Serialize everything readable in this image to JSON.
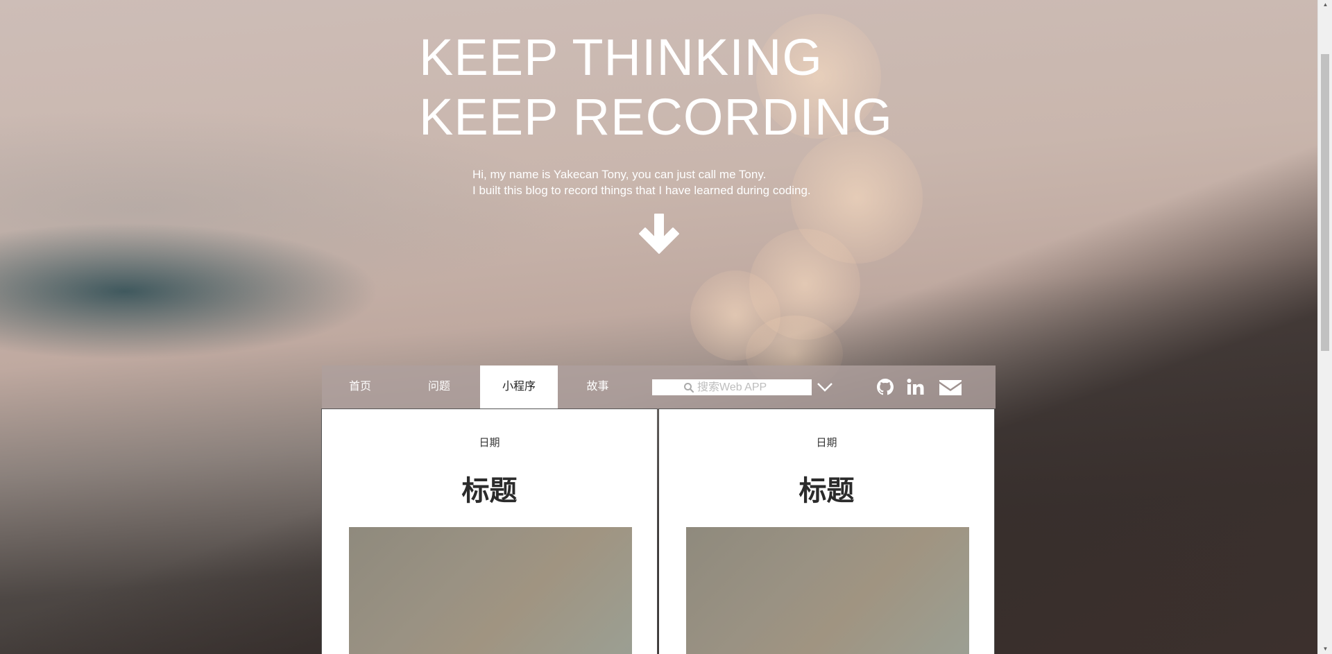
{
  "hero": {
    "title_line1": "KEEP THINKING",
    "title_line2": "KEEP RECORDING",
    "intro_line1": "Hi, my name is Yakecan Tony, you can just call me Tony.",
    "intro_line2": "I built this blog to record things that I have learned during coding.",
    "scroll_icon": "arrow-down-icon"
  },
  "nav": {
    "tabs": [
      {
        "label": "首页",
        "active": false
      },
      {
        "label": "问题",
        "active": false
      },
      {
        "label": "小程序",
        "active": true
      },
      {
        "label": "故事",
        "active": false
      }
    ],
    "search": {
      "placeholder": "搜索Web APP",
      "icon": "search-icon"
    },
    "dropdown_icon": "chevron-down-icon",
    "social": [
      "github-icon",
      "linkedin-icon",
      "envelope-icon"
    ]
  },
  "cards": [
    {
      "date": "日期",
      "title": "标题"
    },
    {
      "date": "日期",
      "title": "标题"
    }
  ],
  "colors": {
    "nav_background": "#afa09e",
    "active_tab": "#ffffff",
    "card_background": "#ffffff",
    "text_light": "#ffffff",
    "text_dark": "#2b2b2b"
  }
}
